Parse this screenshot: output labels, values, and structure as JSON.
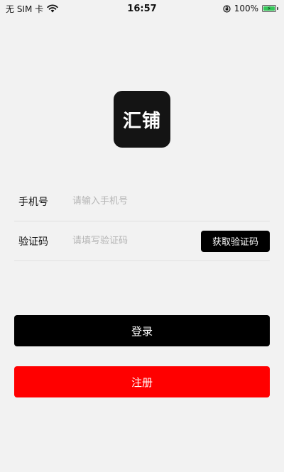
{
  "status_bar": {
    "carrier": "无 SIM 卡",
    "time": "16:57",
    "battery": "100%"
  },
  "logo": {
    "text": "汇铺"
  },
  "form": {
    "phone": {
      "label": "手机号",
      "placeholder": "请输入手机号",
      "value": ""
    },
    "code": {
      "label": "验证码",
      "placeholder": "请填写验证码",
      "value": "",
      "button_label": "获取验证码"
    }
  },
  "actions": {
    "login_label": "登录",
    "register_label": "注册"
  },
  "colors": {
    "background": "#f2f2f2",
    "primary": "#000000",
    "register": "#ff0000",
    "battery": "#34c759"
  }
}
